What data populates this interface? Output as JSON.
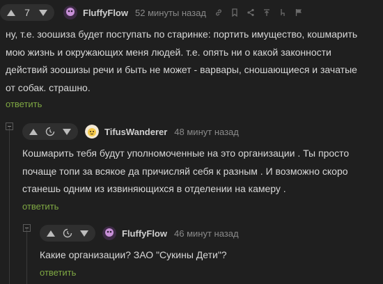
{
  "comments": [
    {
      "score": "7",
      "author": "FluffyFlow",
      "time": "52 минуты назад",
      "text": "ну, т.е. зоошиза будет поступать по старинке: портить имущество, кошмарить мою жизнь и окружающих меня людей. т.е. опять ни о какой законности действий зоошизы речи и быть не может - варвары, сношающиеся и зачатые от собак. страшно.",
      "reply_label": "ответить"
    },
    {
      "author": "TifusWanderer",
      "time": "48 минут назад",
      "text": "Кошмарить тебя будут уполномоченные на это организации . Ты просто почаще топи за всякое да причисляй себя к разным . И возможно скоро станешь одним из извиняющихся в отделении на камеру .",
      "reply_label": "ответить"
    },
    {
      "author": "FluffyFlow",
      "time": "46 минут назад",
      "text": "Какие организации? ЗАО \"Сукины Дети\"?",
      "reply_label": "ответить"
    }
  ],
  "icons": {
    "toolbar": [
      "link-icon",
      "bookmark-icon",
      "share-icon",
      "pin-up-icon",
      "subthread-icon",
      "flag-icon"
    ]
  },
  "colors": {
    "background": "#1f1f1f",
    "reply_link": "#7fa843",
    "meta_text": "#8a8a8a"
  }
}
